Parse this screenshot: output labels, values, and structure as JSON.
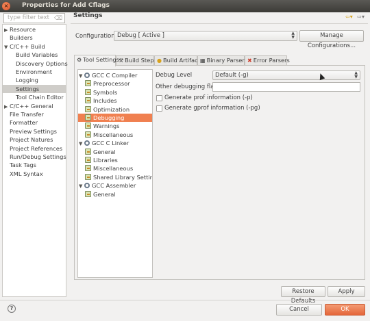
{
  "window": {
    "title": "Properties for Add Cflags"
  },
  "left": {
    "filter_placeholder": "type filter text",
    "items": [
      {
        "label": "Resource",
        "arrow": "▶",
        "indent": 0
      },
      {
        "label": "Builders",
        "arrow": "",
        "indent": 0
      },
      {
        "label": "C/C++ Build",
        "arrow": "▼",
        "indent": 0
      },
      {
        "label": "Build Variables",
        "arrow": "",
        "indent": 1
      },
      {
        "label": "Discovery Options",
        "arrow": "",
        "indent": 1
      },
      {
        "label": "Environment",
        "arrow": "",
        "indent": 1
      },
      {
        "label": "Logging",
        "arrow": "",
        "indent": 1
      },
      {
        "label": "Settings",
        "arrow": "",
        "indent": 1,
        "selected": true
      },
      {
        "label": "Tool Chain Editor",
        "arrow": "",
        "indent": 1
      },
      {
        "label": "C/C++ General",
        "arrow": "▶",
        "indent": 0
      },
      {
        "label": "File Transfer",
        "arrow": "",
        "indent": 0
      },
      {
        "label": "Formatter",
        "arrow": "",
        "indent": 0
      },
      {
        "label": "Preview Settings",
        "arrow": "",
        "indent": 0
      },
      {
        "label": "Project Natures",
        "arrow": "",
        "indent": 0
      },
      {
        "label": "Project References",
        "arrow": "",
        "indent": 0
      },
      {
        "label": "Run/Debug Settings",
        "arrow": "",
        "indent": 0
      },
      {
        "label": "Task Tags",
        "arrow": "",
        "indent": 0
      },
      {
        "label": "XML Syntax",
        "arrow": "",
        "indent": 0
      }
    ]
  },
  "page": {
    "title": "Settings",
    "configuration_label": "Configuration:",
    "configuration_value": "Debug  [ Active ]",
    "manage_button": "Manage Configurations...",
    "tabs": [
      {
        "label": "Tool Settings",
        "icon": "⚙",
        "active": true
      },
      {
        "label": "Build Steps",
        "icon": "🔧"
      },
      {
        "label": "Build Artifact",
        "icon": "●"
      },
      {
        "label": "Binary Parsers",
        "icon": "▦"
      },
      {
        "label": "Error Parsers",
        "icon": "✖"
      }
    ],
    "tool_tree": [
      {
        "label": "GCC C Compiler",
        "type": "tool",
        "indent": 0
      },
      {
        "label": "Preprocessor",
        "type": "option",
        "indent": 1
      },
      {
        "label": "Symbols",
        "type": "option",
        "indent": 1
      },
      {
        "label": "Includes",
        "type": "option",
        "indent": 1
      },
      {
        "label": "Optimization",
        "type": "option",
        "indent": 1
      },
      {
        "label": "Debugging",
        "type": "option",
        "indent": 1,
        "selected": true
      },
      {
        "label": "Warnings",
        "type": "option",
        "indent": 1
      },
      {
        "label": "Miscellaneous",
        "type": "option",
        "indent": 1
      },
      {
        "label": "GCC C Linker",
        "type": "tool",
        "indent": 0
      },
      {
        "label": "General",
        "type": "option",
        "indent": 1
      },
      {
        "label": "Libraries",
        "type": "option",
        "indent": 1
      },
      {
        "label": "Miscellaneous",
        "type": "option",
        "indent": 1
      },
      {
        "label": "Shared Library Settings",
        "type": "option",
        "indent": 1
      },
      {
        "label": "GCC Assembler",
        "type": "tool",
        "indent": 0
      },
      {
        "label": "General",
        "type": "option",
        "indent": 1
      }
    ],
    "debug_level_label": "Debug Level",
    "debug_level_value": "Default (-g)",
    "other_flags_label": "Other debugging flags",
    "other_flags_value": "",
    "prof_label": "Generate prof information (-p)",
    "gprof_label": "Generate gprof information (-pg)",
    "restore_defaults": "Restore Defaults",
    "apply": "Apply"
  },
  "footer": {
    "cancel": "Cancel",
    "ok": "OK",
    "help": "?"
  }
}
